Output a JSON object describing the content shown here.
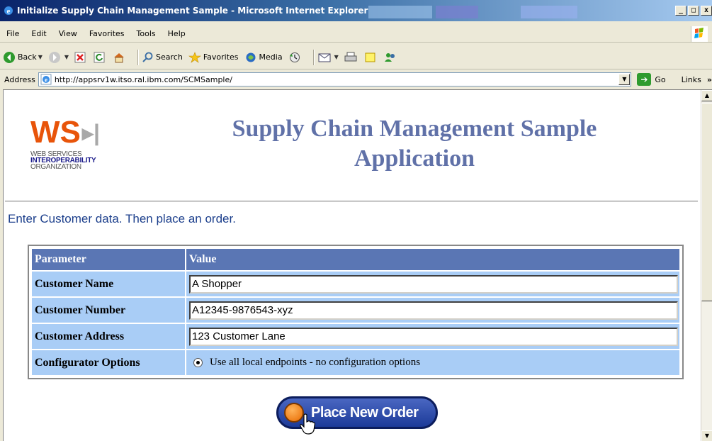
{
  "window": {
    "title": "Initialize Supply Chain Management Sample - Microsoft Internet Explorer",
    "minimize": "_",
    "maximize": "□",
    "close": "x"
  },
  "menu": [
    "File",
    "Edit",
    "View",
    "Favorites",
    "Tools",
    "Help"
  ],
  "toolbar": {
    "back_label": "Back",
    "search_label": "Search",
    "favorites_label": "Favorites",
    "media_label": "Media"
  },
  "address": {
    "label": "Address",
    "url": "http://appsrv1w.itso.ral.ibm.com/SCMSample/",
    "go_label": "Go",
    "links_label": "Links",
    "links_chevron": "»"
  },
  "page": {
    "logo": {
      "mark": "WS",
      "separator": "▸|",
      "line1": "WEB SERVICES",
      "line2": "INTEROPERABILITY",
      "line3": "ORGANIZATION"
    },
    "heading_line1": "Supply Chain Management Sample",
    "heading_line2": "Application",
    "instruction": "Enter Customer data. Then place an order.",
    "table": {
      "headers": [
        "Parameter",
        "Value"
      ],
      "rows": [
        {
          "param": "Customer Name",
          "value": "A Shopper"
        },
        {
          "param": "Customer Number",
          "value": "A12345-9876543-xyz"
        },
        {
          "param": "Customer Address",
          "value": "123 Customer Lane"
        },
        {
          "param": "Configurator Options",
          "option": "Use all local endpoints - no configuration options"
        }
      ]
    },
    "order_button": "Place New Order"
  },
  "colors": {
    "heading": "#6071a8",
    "instruction": "#1c3f8c",
    "table_header": "#5a76b4",
    "table_cell": "#a9cdf6",
    "logo_orange": "#e8540a"
  }
}
